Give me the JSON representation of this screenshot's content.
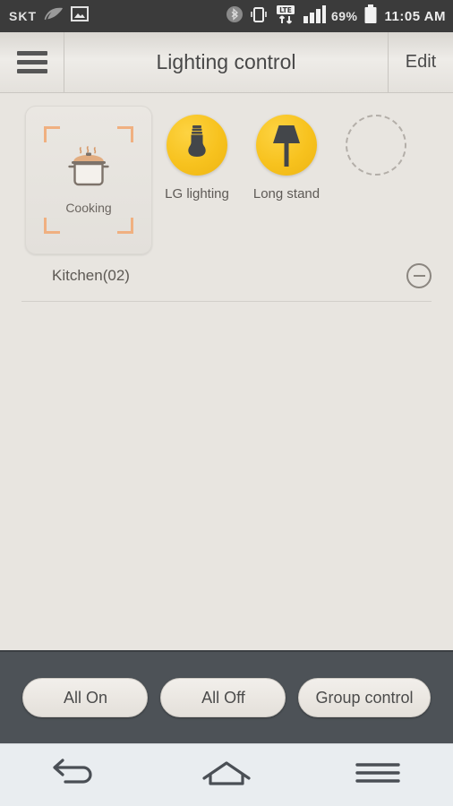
{
  "statusbar": {
    "carrier": "SKT",
    "battery_percent": "69%",
    "time": "11:05 AM",
    "icons": [
      "leaf-icon",
      "image-icon",
      "bluetooth-icon",
      "vibrate-icon",
      "lte-icon",
      "signal-bars-icon",
      "battery-icon"
    ],
    "background": "#3b3b3b"
  },
  "header": {
    "menu_icon": "hamburger-menu-icon",
    "title": "Lighting control",
    "edit_label": "Edit"
  },
  "group": {
    "name": "Kitchen(02)",
    "scene": {
      "label": "Cooking",
      "icon": "cooking-pot-icon",
      "accent_color": "#f0b080"
    },
    "devices": [
      {
        "label": "LG lighting",
        "icon": "light-bulb-icon",
        "state": "on",
        "color": "#f7c21e"
      },
      {
        "label": "Long stand",
        "icon": "floor-lamp-icon",
        "state": "on",
        "color": "#f7c21e"
      },
      {
        "label": "",
        "icon": "empty-slot-icon",
        "state": "empty",
        "color": "#b3aea8"
      }
    ],
    "collapse_icon": "minus-circle-icon"
  },
  "actionbar": {
    "buttons": [
      {
        "label": "All On"
      },
      {
        "label": "All Off"
      },
      {
        "label": "Group control"
      }
    ],
    "background": "#4d5257"
  },
  "navbar": {
    "back_icon": "back-arrow-icon",
    "home_icon": "home-icon",
    "recents_icon": "recent-apps-icon"
  }
}
